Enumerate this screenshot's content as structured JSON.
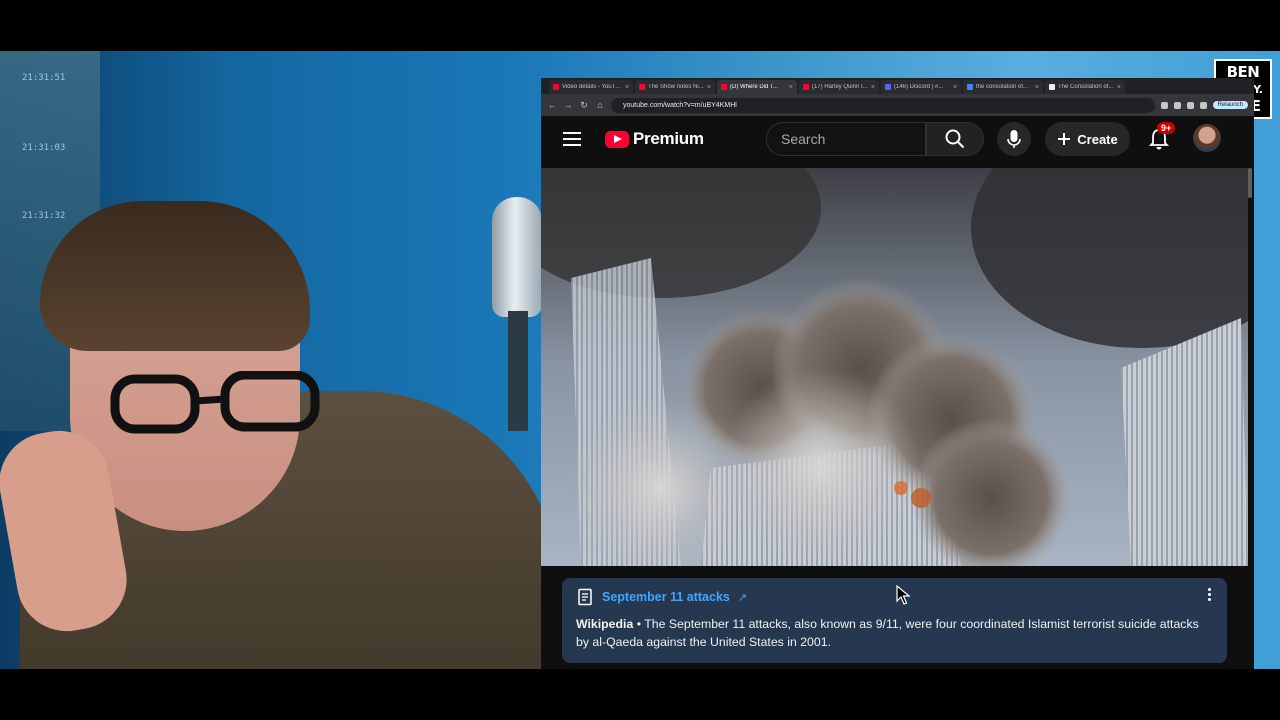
{
  "overlay": {
    "logo_line1": "BEN",
    "logo_line2": "AVERY.",
    "logo_line3": "LIVE"
  },
  "webcam": {
    "clocks": [
      "21:31:51",
      "21:31:03",
      "21:31:32"
    ]
  },
  "browser": {
    "tabs": [
      {
        "label": "Video details - YouTube"
      },
      {
        "label": "The Show notes Ni..."
      },
      {
        "label": "(D) Where Did T..."
      },
      {
        "label": "(17) Harley Quinn I..."
      },
      {
        "label": "(146) Discord | #..."
      },
      {
        "label": "the consolation of..."
      },
      {
        "label": "The Consolation of..."
      }
    ],
    "url": "youtube.com/watch?v=m/uBY4KMHl",
    "relaunch_label": "Relaunch"
  },
  "youtube": {
    "logo_text": "Premium",
    "search_placeholder": "Search",
    "create_label": "Create",
    "notification_badge": "9+"
  },
  "info_panel": {
    "title": "September 11 attacks",
    "external_icon": "↗",
    "source": "Wikipedia",
    "separator": " • ",
    "description": "The September 11 attacks, also known as 9/11, were four coordinated Islamist terrorist suicide attacks by al-Qaeda against the United States in 2001."
  },
  "icons": [
    "menu-icon",
    "search-icon",
    "microphone-icon",
    "plus-icon",
    "bell-icon",
    "document-icon",
    "more-vert-icon",
    "cursor-icon"
  ],
  "colors": {
    "youtube_red": "#ff0033",
    "link_blue": "#3ea6ff",
    "panel_bg": "#263850",
    "page_bg": "#0f0f0f"
  }
}
